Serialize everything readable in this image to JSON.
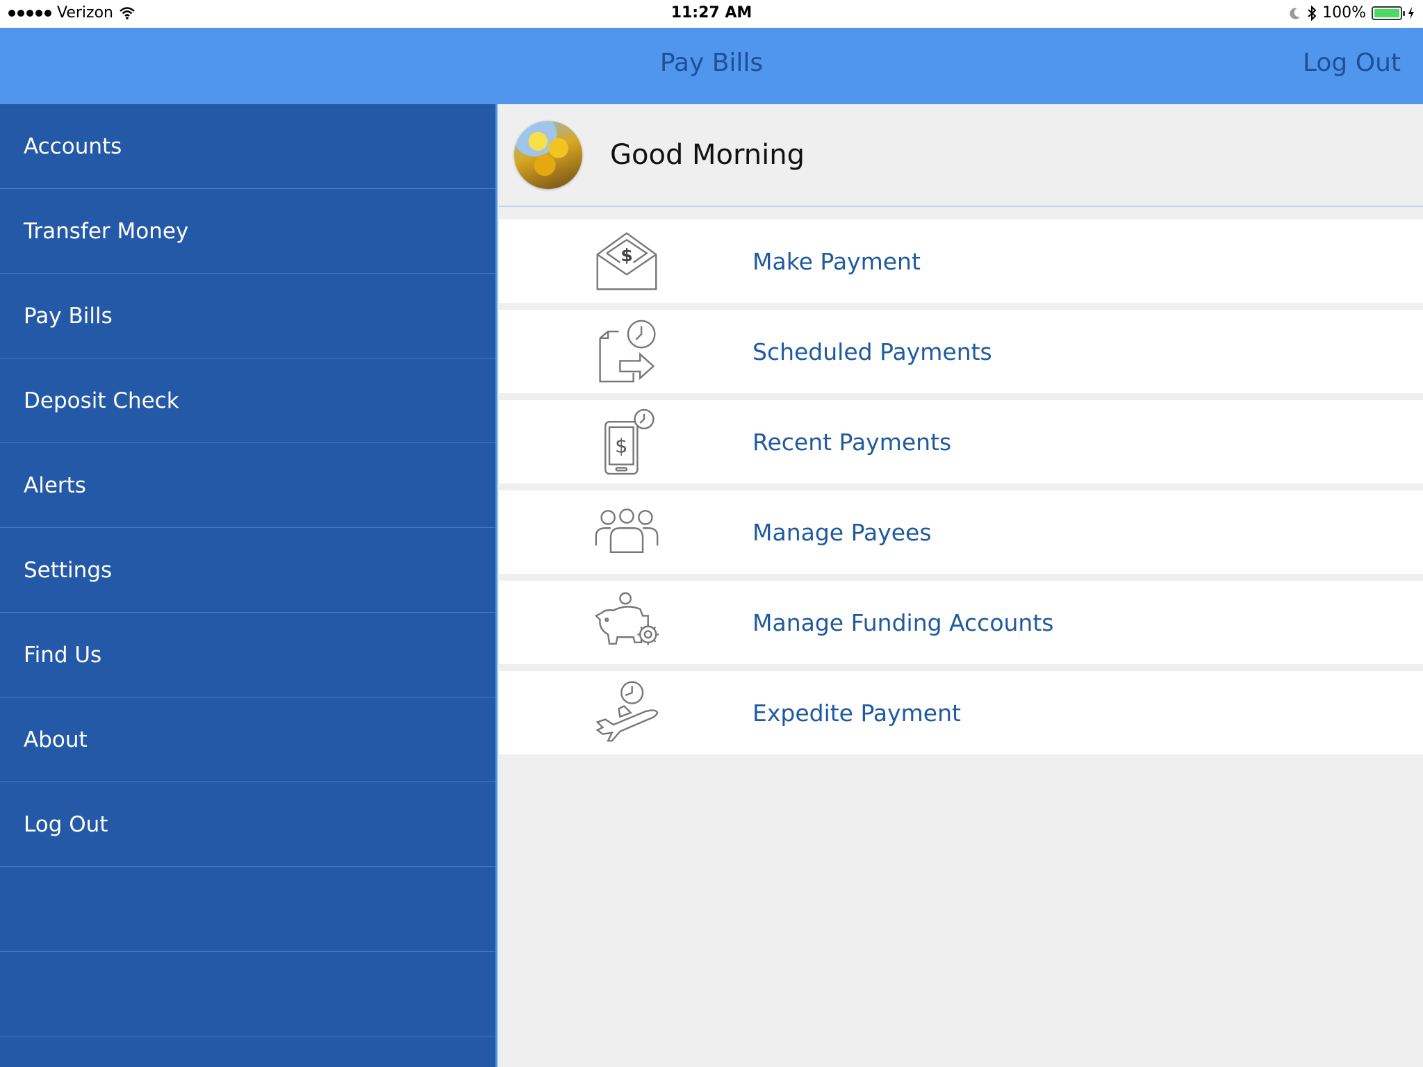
{
  "status_bar": {
    "carrier": "Verizon",
    "time": "11:27 AM",
    "battery_percent": "100%",
    "battery_level": 1.0
  },
  "header": {
    "title": "Pay Bills",
    "logout_label": "Log Out"
  },
  "sidebar": {
    "items": [
      {
        "label": "Accounts"
      },
      {
        "label": "Transfer Money"
      },
      {
        "label": "Pay Bills"
      },
      {
        "label": "Deposit Check"
      },
      {
        "label": "Alerts"
      },
      {
        "label": "Settings"
      },
      {
        "label": "Find Us"
      },
      {
        "label": "About"
      },
      {
        "label": "Log Out"
      }
    ]
  },
  "main": {
    "greeting": "Good Morning",
    "menu": [
      {
        "label": "Make Payment",
        "icon": "envelope-dollar-icon"
      },
      {
        "label": "Scheduled Payments",
        "icon": "document-clock-arrow-icon"
      },
      {
        "label": "Recent Payments",
        "icon": "phone-dollar-clock-icon"
      },
      {
        "label": "Manage Payees",
        "icon": "people-group-icon"
      },
      {
        "label": "Manage Funding Accounts",
        "icon": "piggy-bank-gear-icon"
      },
      {
        "label": "Expedite Payment",
        "icon": "airplane-clock-icon"
      }
    ]
  },
  "colors": {
    "header_bg": "#4f96ec",
    "header_text": "#1f4f9a",
    "sidebar_bg": "#2359a6",
    "sidebar_text": "#ffffff",
    "menu_link": "#1f5aa0",
    "content_bg": "#efefef"
  }
}
